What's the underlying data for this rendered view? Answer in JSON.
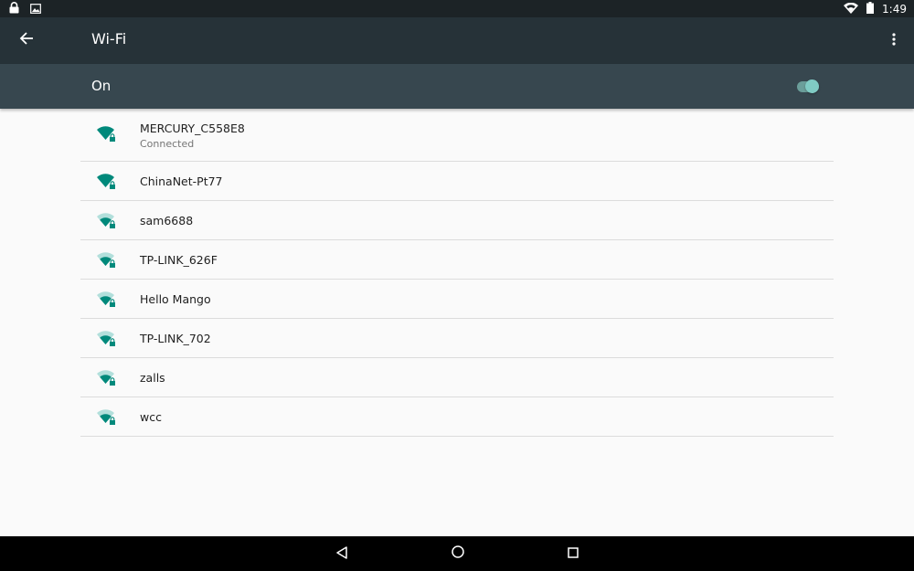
{
  "status_bar": {
    "time": "1:49",
    "left_icons": [
      "lock-icon",
      "image-icon"
    ],
    "right_icons": [
      "wifi-signal-icon",
      "battery-icon"
    ]
  },
  "header": {
    "title": "Wi-Fi",
    "back_icon": "arrow-left-icon",
    "more_icon": "more-vert-icon"
  },
  "wifi_switch": {
    "label": "On",
    "enabled": true
  },
  "networks": [
    {
      "ssid": "MERCURY_C558E8",
      "status": "Connected",
      "signal": "full",
      "secured": true
    },
    {
      "ssid": "ChinaNet-Pt77",
      "status": "",
      "signal": "full",
      "secured": true
    },
    {
      "ssid": "sam6688",
      "status": "",
      "signal": "medium",
      "secured": true
    },
    {
      "ssid": "TP-LINK_626F",
      "status": "",
      "signal": "medium",
      "secured": true
    },
    {
      "ssid": "Hello Mango",
      "status": "",
      "signal": "medium",
      "secured": true
    },
    {
      "ssid": "TP-LINK_702",
      "status": "",
      "signal": "medium",
      "secured": true
    },
    {
      "ssid": "zalls",
      "status": "",
      "signal": "medium",
      "secured": true
    },
    {
      "ssid": "wcc",
      "status": "",
      "signal": "medium",
      "secured": true
    }
  ],
  "nav_bar": {
    "icons": [
      "back-triangle-icon",
      "home-circle-icon",
      "recents-square-icon"
    ]
  },
  "colors": {
    "accent": "#009688",
    "status_bar": "#1c2326",
    "app_bar": "#263238",
    "switch_bar": "#37474f",
    "background": "#fafafa"
  }
}
